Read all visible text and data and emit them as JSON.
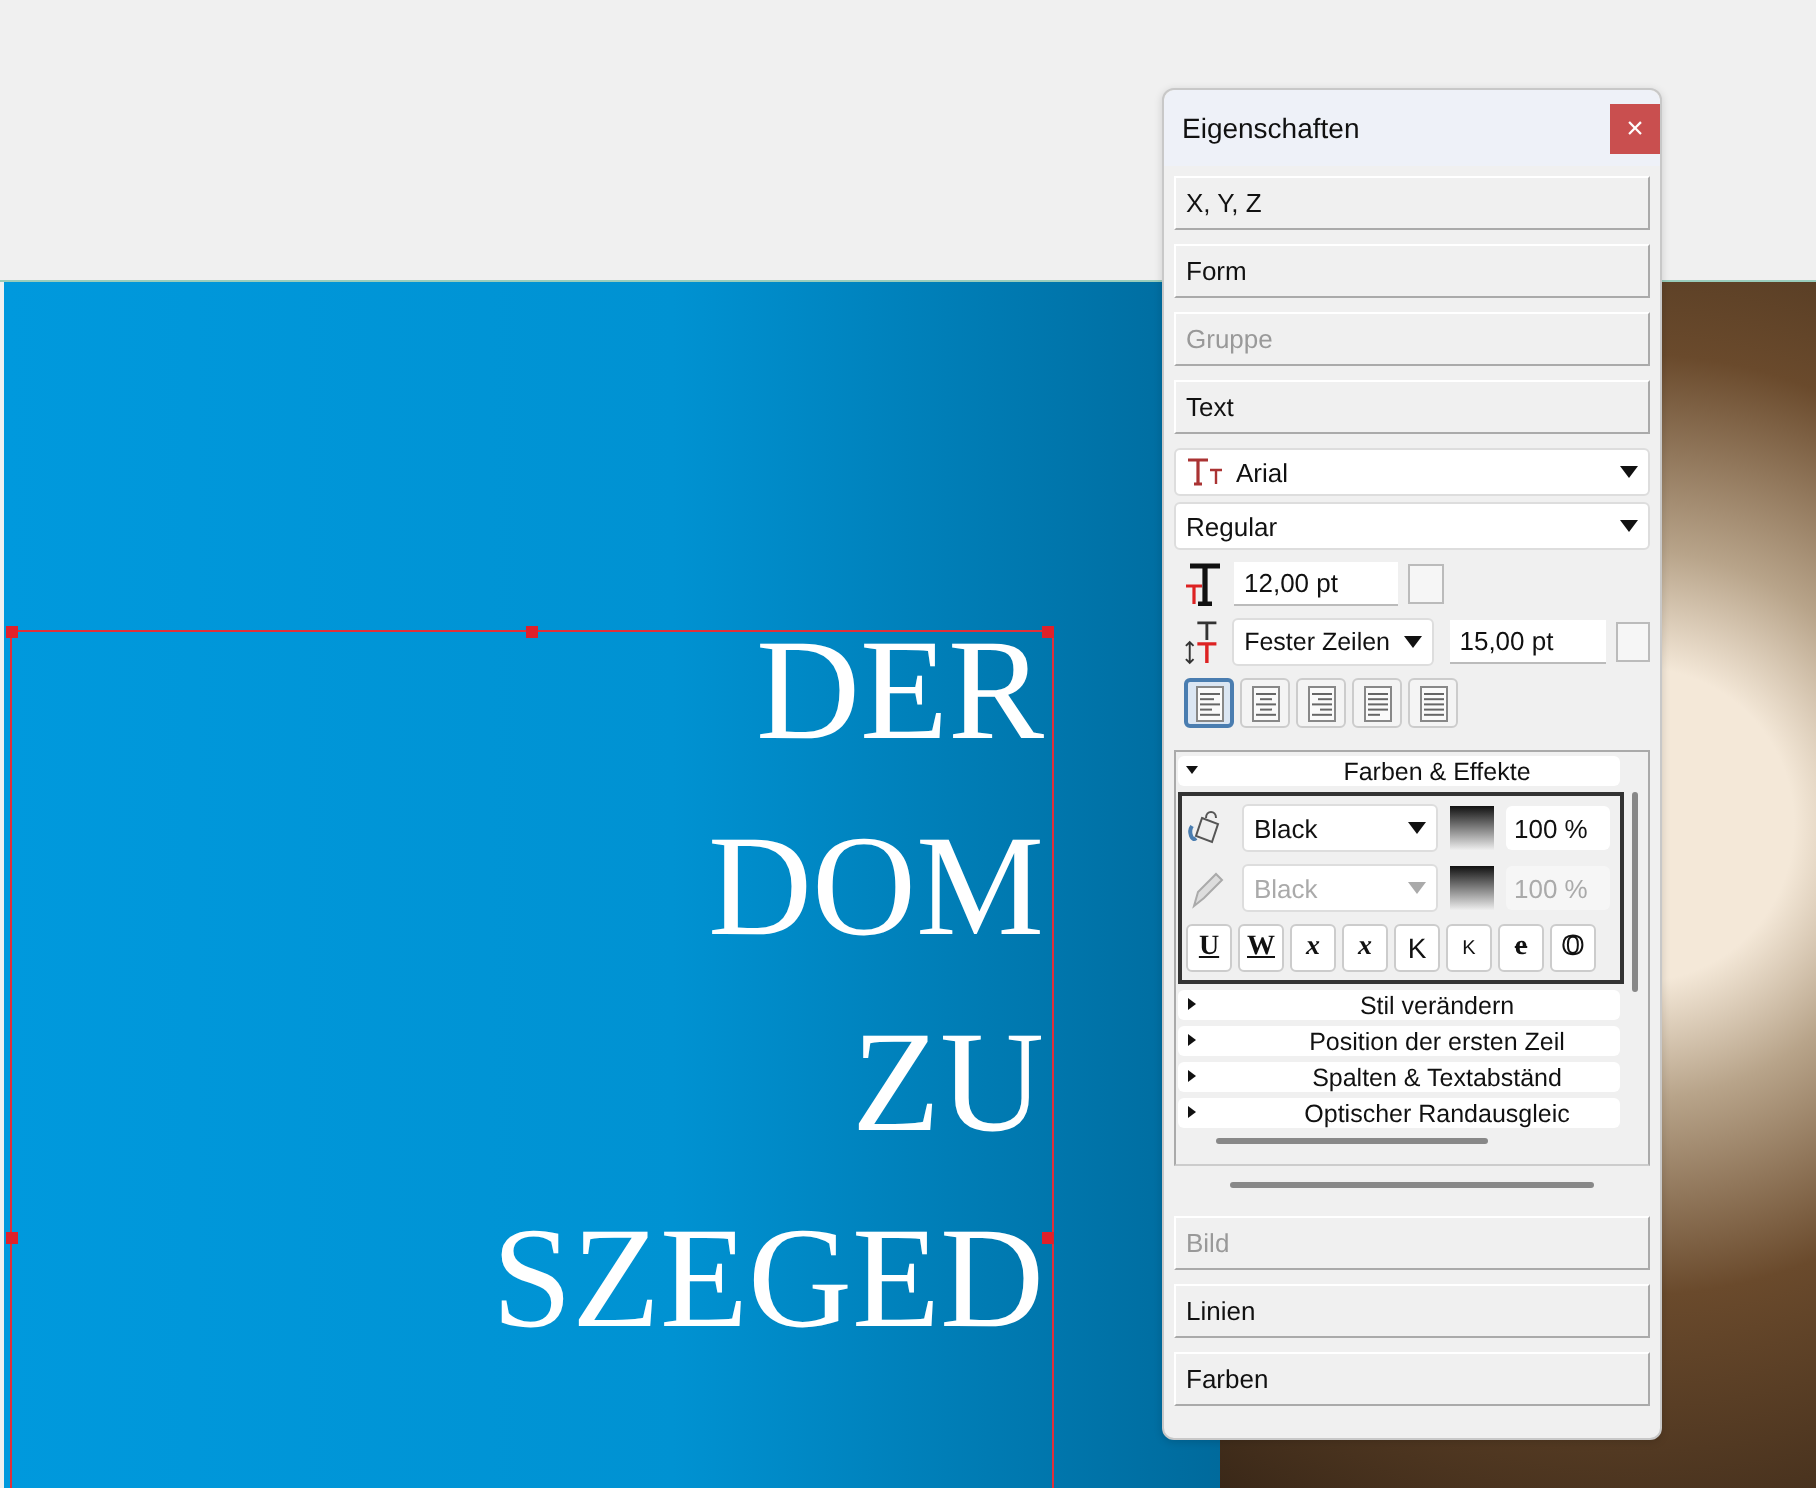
{
  "canvas": {
    "headline_lines": [
      "DER",
      "DOM",
      "ZU",
      "SZEGED"
    ]
  },
  "panel": {
    "title": "Eigenschaften",
    "close_label": "×",
    "sections_top": [
      {
        "label": "X, Y, Z",
        "disabled": false
      },
      {
        "label": "Form",
        "disabled": false
      },
      {
        "label": "Gruppe",
        "disabled": true
      },
      {
        "label": "Text",
        "disabled": false
      }
    ],
    "font": {
      "family": "Arial",
      "style": "Regular",
      "size": "12,00 pt",
      "line_spacing_mode": "Fester Zeilen",
      "line_spacing": "15,00 pt"
    },
    "alignments": [
      {
        "kind": "left",
        "selected": true
      },
      {
        "kind": "center",
        "selected": false
      },
      {
        "kind": "right",
        "selected": false
      },
      {
        "kind": "justify",
        "selected": false
      },
      {
        "kind": "forced",
        "selected": false
      }
    ],
    "subsections": [
      {
        "title": "Farben & Effekte",
        "expanded": true
      },
      {
        "title": "Stil verändern",
        "expanded": false
      },
      {
        "title": "Position der ersten Zeil",
        "expanded": false
      },
      {
        "title": "Spalten & Textabständ",
        "expanded": false
      },
      {
        "title": "Optischer Randausgleic",
        "expanded": false
      }
    ],
    "color_rows": [
      {
        "kind": "fill",
        "color_name": "Black",
        "opacity": "100 %",
        "disabled": false
      },
      {
        "kind": "stroke",
        "color_name": "Black",
        "opacity": "100 %",
        "disabled": true
      }
    ],
    "style_buttons": [
      {
        "kind": "underline",
        "glyph": "U"
      },
      {
        "kind": "underline-words",
        "glyph": "W"
      },
      {
        "kind": "subscript",
        "glyph": "x"
      },
      {
        "kind": "superscript",
        "glyph": "x"
      },
      {
        "kind": "caps",
        "glyph": "K"
      },
      {
        "kind": "small-caps",
        "glyph": "K"
      },
      {
        "kind": "strike",
        "glyph": "e"
      },
      {
        "kind": "outline",
        "glyph": "O"
      }
    ],
    "sections_bottom": [
      {
        "label": "Bild",
        "disabled": true
      },
      {
        "label": "Linien",
        "disabled": false
      },
      {
        "label": "Farben",
        "disabled": false
      }
    ]
  }
}
